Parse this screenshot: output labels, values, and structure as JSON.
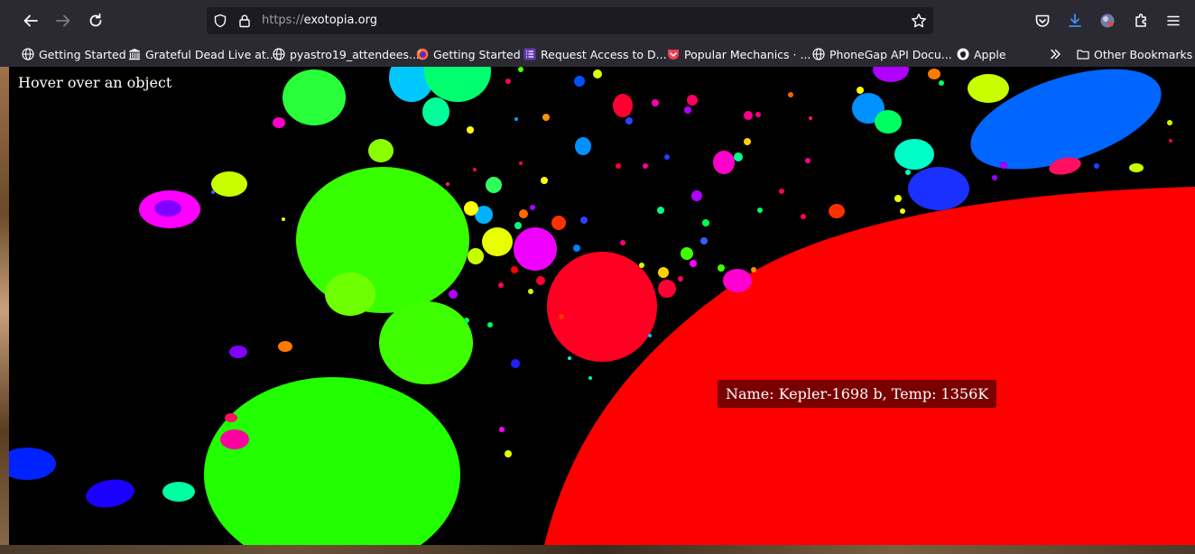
{
  "browser": {
    "url_scheme": "https://",
    "url_host": "exotopia.org",
    "icons": {
      "back": "back-arrow-icon",
      "forward": "forward-arrow-icon",
      "reload": "reload-icon",
      "shield": "tracking-shield-icon",
      "lock": "lock-icon",
      "star": "bookmark-star-icon",
      "pocket": "pocket-icon",
      "downloads": "download-icon",
      "account": "account-avatar-icon",
      "extensions": "extensions-icon",
      "menu": "hamburger-menu-icon"
    }
  },
  "bookmarks": [
    {
      "label": "Getting Started",
      "icon": "globe-icon"
    },
    {
      "label": "Grateful Dead Live at...",
      "icon": "archive-icon"
    },
    {
      "label": "pyastro19_attendees...",
      "icon": "globe-icon"
    },
    {
      "label": "Getting Started",
      "icon": "firefox-icon"
    },
    {
      "label": "Request Access to D...",
      "icon": "list-icon"
    },
    {
      "label": "Popular Mechanics · ...",
      "icon": "pocket-icon"
    },
    {
      "label": "PhoneGap API Docu...",
      "icon": "globe-icon"
    },
    {
      "label": "Apple",
      "icon": "apple-icon"
    }
  ],
  "bookmarks_overflow_icon": "chevron-double-right-icon",
  "other_bookmarks": {
    "label": "Other Bookmarks",
    "icon": "folder-icon"
  },
  "page": {
    "hover_prompt": "Hover over an object",
    "tooltip": "Name: Kepler-1698 b, Temp: 1356K"
  }
}
